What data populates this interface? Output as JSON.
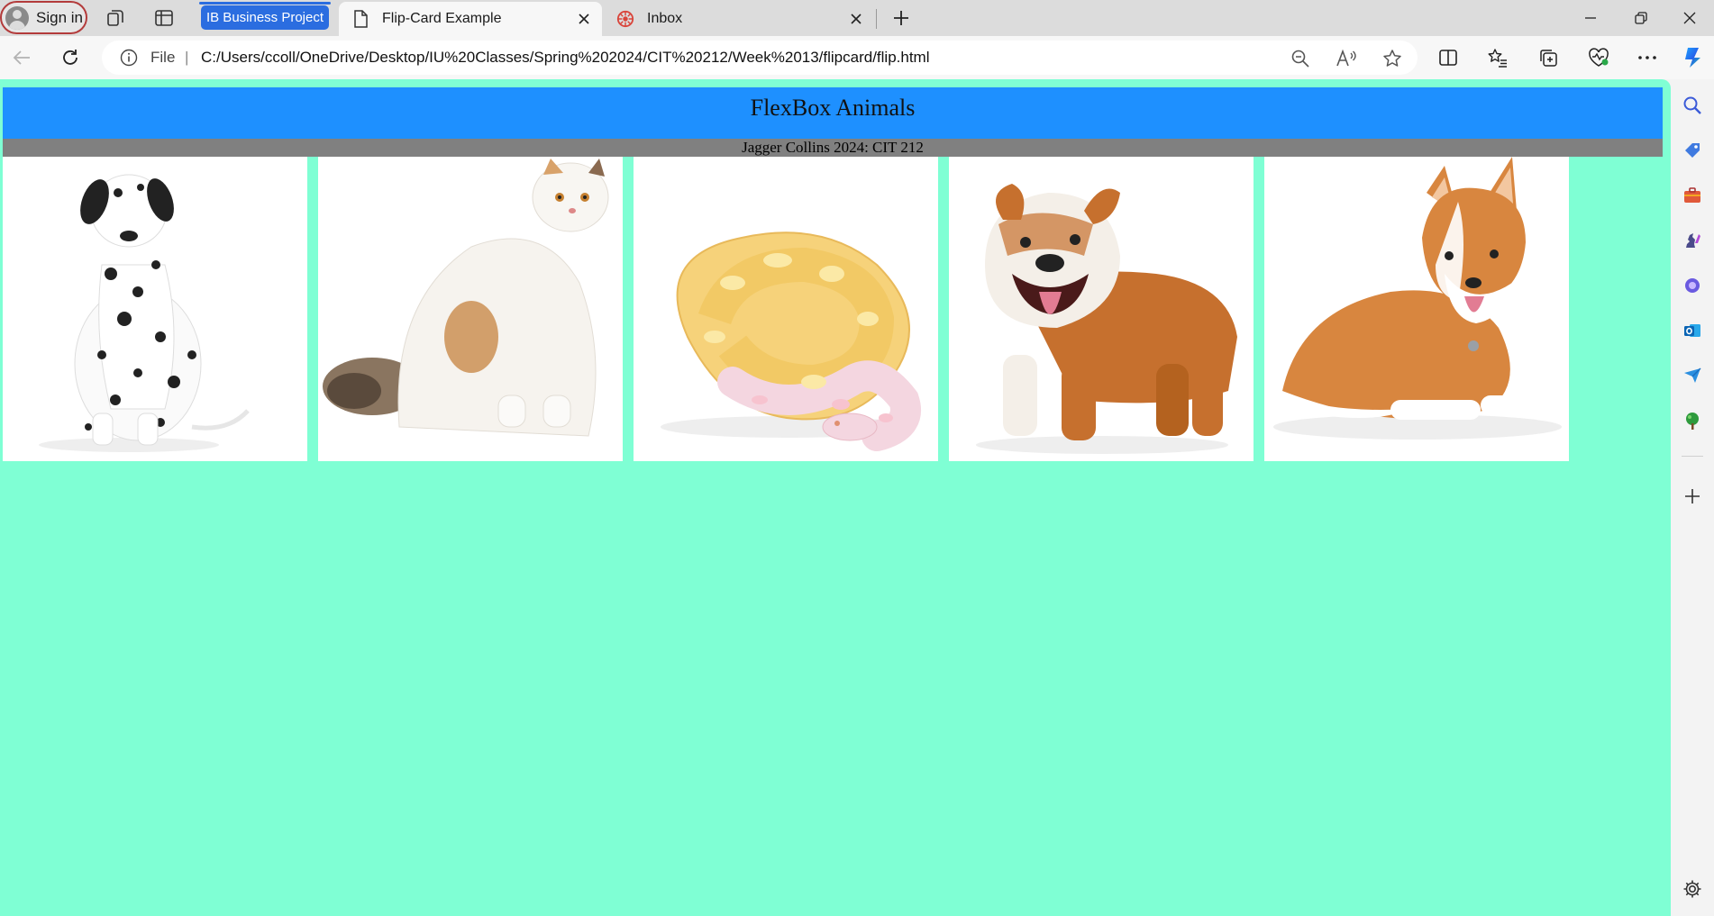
{
  "browser": {
    "signin_label": "Sign in",
    "tab_group_label": "IB Business Project",
    "tabs": [
      {
        "title": "Flip-Card Example",
        "active": true,
        "icon": "page-icon"
      },
      {
        "title": "Inbox",
        "active": false,
        "icon": "mail-icon"
      }
    ],
    "address": {
      "scheme_label": "File",
      "url": "C:/Users/ccoll/OneDrive/Desktop/IU%20Classes/Spring%202024/CIT%20212/Week%2013/flipcard/flip.html"
    },
    "sidebar_icons": [
      "search-icon",
      "tag-icon",
      "briefcase-icon",
      "chess-icon",
      "copilot-icon",
      "outlook-icon",
      "send-icon",
      "tree-icon",
      "add-icon",
      "settings-icon"
    ]
  },
  "page": {
    "title": "FlexBox Animals",
    "subtitle": "Jagger Collins 2024: CIT 212",
    "background_color": "#7fffd4",
    "banner_color": "#1e90ff",
    "subbar_color": "#808080",
    "cards": [
      {
        "animal": "dalmatian"
      },
      {
        "animal": "persian-cat"
      },
      {
        "animal": "albino-python"
      },
      {
        "animal": "english-bulldog"
      },
      {
        "animal": "corgi"
      }
    ]
  }
}
